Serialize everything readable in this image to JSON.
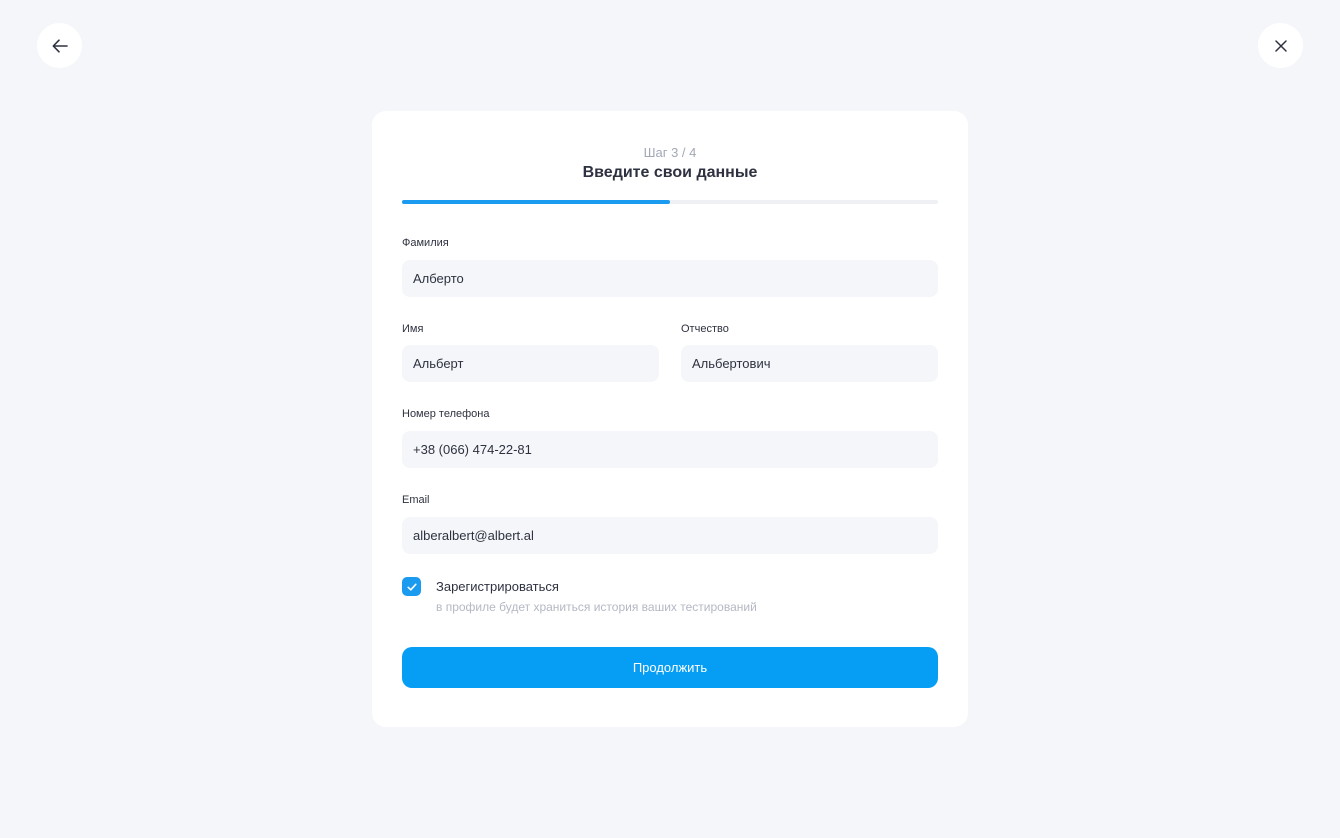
{
  "nav": {
    "back_icon": "arrow-left-icon",
    "close_icon": "close-icon"
  },
  "header": {
    "step": "Шаг 3 / 4",
    "title": "Введите свои данные",
    "progress_fraction": 0.5
  },
  "form": {
    "last_name": {
      "label": "Фамилия",
      "value": "Алберто"
    },
    "first_name": {
      "label": "Имя",
      "value": "Альберт"
    },
    "middle_name": {
      "label": "Отчество",
      "value": "Альбертович"
    },
    "phone": {
      "label": "Номер телефона",
      "value": "+38 (066) 474-22-81"
    },
    "email": {
      "label": "Email",
      "value": "alberalbert@albert.al"
    },
    "register": {
      "checked": true,
      "label": "Зарегистрироваться",
      "hint": "в профиле будет храниться история ваших тестирований"
    },
    "submit_label": "Продолжить"
  },
  "colors": {
    "accent": "#069ef5",
    "background": "#f4f6f9",
    "card": "#ffffff",
    "text": "#2e3240",
    "muted": "#a3a8b6"
  }
}
